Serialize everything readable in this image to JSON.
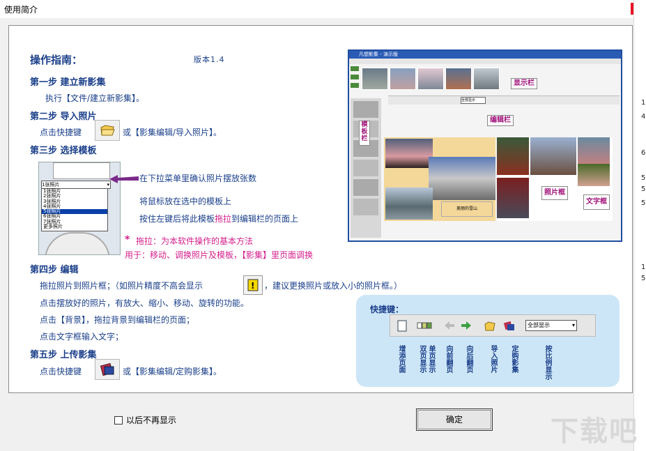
{
  "window": {
    "title": "使用简介",
    "close_glyph": "✕"
  },
  "guide": {
    "title": "操作指南：",
    "version": "版本1.4",
    "step1": {
      "heading": "第一步  建立新影集",
      "text": "执行【文件/建立新影集】。"
    },
    "step2": {
      "heading": "第二步  导入照片",
      "prefix": "点击快捷键",
      "suffix": "或【影集编辑/导入照片】。"
    },
    "step3": {
      "heading": "第三步  选择模板",
      "note1": "在下拉菜单里确认照片摆放张数",
      "note2": "将鼠标放在选中的模板上",
      "note3a": "按住左键后将此模板",
      "note3b": "拖拉",
      "note3c": "到编辑栏的页面上",
      "star": "*",
      "drag_tip": "拖拉：为本软件操作的基本方法",
      "usage": "用于：移动、调换照片及模板，【影集】里页面调换",
      "dropdown_value": "1张照片",
      "dropdown_options": [
        "1张照片",
        "2张照片",
        "3张照片",
        "4张照片",
        "5张照片",
        "6张照片",
        "7张照片",
        "更多照片"
      ],
      "dropdown_selected": 4
    },
    "step4": {
      "heading": "第四步  编辑",
      "line1a": "拖拉照片到照片框；（如照片精度不高会显示",
      "line1b": "，建议更换照片或放入小的照片框。）",
      "line2": "点击摆放好的照片，有放大、缩小、移动、旋转的功能。",
      "line3": "点击【背景】，拖拉背景到编辑栏的页面；",
      "line4": "点击文字框输入文字；"
    },
    "step5": {
      "heading": "第五步  上传影集",
      "prefix": "点击快捷键",
      "suffix": "或【影集编辑/定购影集】。"
    }
  },
  "screenshot": {
    "titlebar": "凡想影集 - 演示版",
    "display_label": "显示栏",
    "edit_label": "编辑栏",
    "template_label": "模板栏",
    "photo_frame_label": "照片框",
    "text_frame_label": "文字框",
    "caption": "美丽的雪山",
    "zoom": "全部显示"
  },
  "quick_keys": {
    "title": "快捷键：",
    "select_value": "全部显示",
    "labels": [
      "增添页面",
      "双页显示",
      "单页显示",
      "向前翻页",
      "向后翻页",
      "导入照片",
      "定购影集",
      "按比例显示"
    ]
  },
  "footer": {
    "checkbox_label": "以后不再显示",
    "ok_label": "确定",
    "watermark": "下载吧"
  },
  "right_strip": [
    "1",
    "4",
    "6",
    "5",
    "5",
    "5",
    "1",
    "5"
  ],
  "colors": {
    "heading": "#1a3f8a",
    "accent": "#d4208c",
    "panel_bg": "#cde6f7",
    "close": "#e81123"
  }
}
